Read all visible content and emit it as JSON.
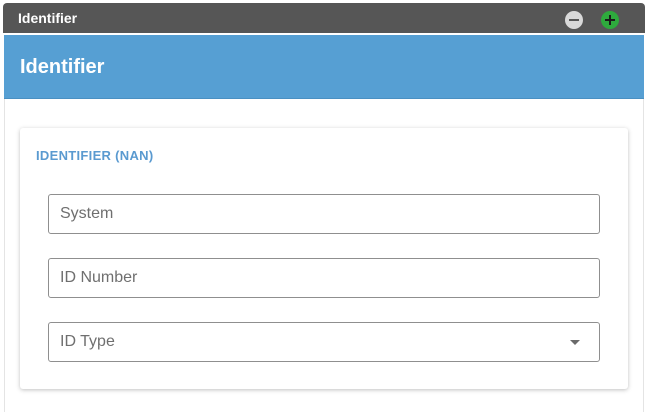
{
  "window": {
    "title": "Identifier"
  },
  "controls": {
    "minus_icon": "minus-circle-icon",
    "plus_icon": "plus-circle-icon"
  },
  "header": {
    "title": "Identifier"
  },
  "card": {
    "title": "IDENTIFIER (NAN)",
    "fields": [
      {
        "placeholder": "System",
        "value": ""
      },
      {
        "placeholder": "ID Number",
        "value": ""
      },
      {
        "placeholder": "ID Type",
        "value": "",
        "type": "select"
      }
    ]
  },
  "colors": {
    "titlebar": "#565656",
    "header": "#569fd3",
    "accent_text": "#5a9ad0",
    "plus_button": "#2eaa3d",
    "minus_button": "#d9d9d9"
  }
}
